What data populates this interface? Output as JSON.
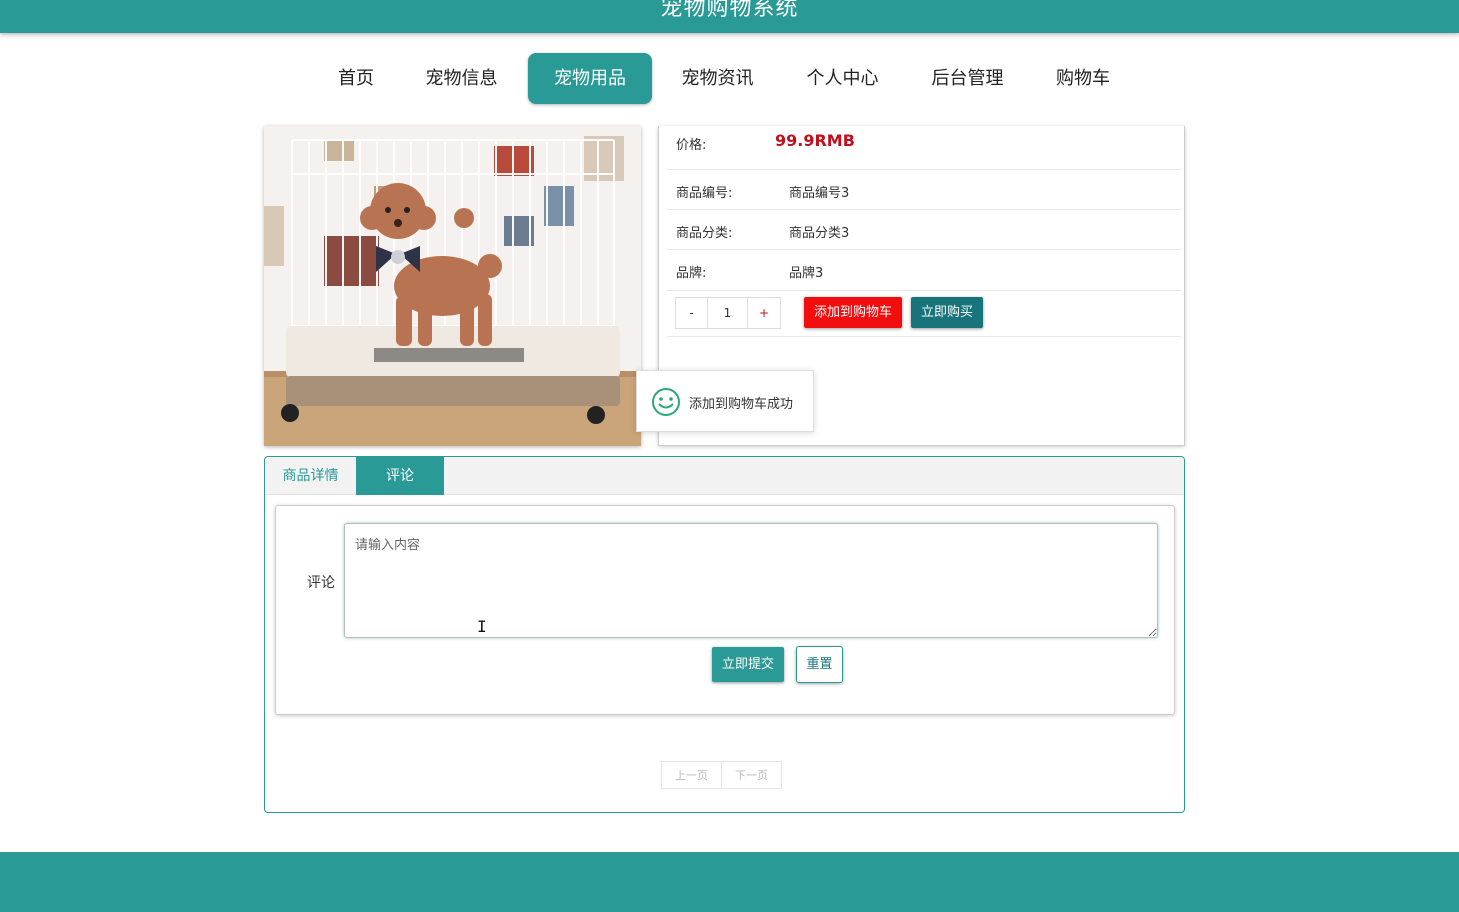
{
  "site": {
    "title": "宠物购物系统"
  },
  "nav": {
    "items": [
      {
        "label": "首页",
        "active": false
      },
      {
        "label": "宠物信息",
        "active": false
      },
      {
        "label": "宠物用品",
        "active": true
      },
      {
        "label": "宠物资讯",
        "active": false
      },
      {
        "label": "个人中心",
        "active": false
      },
      {
        "label": "后台管理",
        "active": false
      },
      {
        "label": "购物车",
        "active": false
      }
    ]
  },
  "product": {
    "image_icon": "dog-in-cage-photo",
    "price": {
      "label": "价格:",
      "value": "99.9RMB"
    },
    "fields": [
      {
        "label": "商品编号:",
        "value": "商品编号3"
      },
      {
        "label": "商品分类:",
        "value": "商品分类3"
      },
      {
        "label": "品牌:",
        "value": "品牌3"
      }
    ],
    "quantity": {
      "minus": "-",
      "value": "1",
      "plus": "+"
    },
    "add_to_cart_label": "添加到购物车",
    "buy_now_label": "立即购买"
  },
  "toast": {
    "icon": "smile-icon",
    "text": "添加到购物车成功"
  },
  "tabs": {
    "items": [
      {
        "label": "商品详情",
        "active": false
      },
      {
        "label": "评论",
        "active": true
      }
    ]
  },
  "comment_form": {
    "label": "评论",
    "placeholder": "请输入内容",
    "submit_label": "立即提交",
    "reset_label": "重置"
  },
  "pager": {
    "prev_label": "上一页",
    "next_label": "下一页"
  },
  "colors": {
    "primary": "#2a9a97",
    "dark_teal": "#18747a",
    "red": "#f20e0e",
    "price_red": "#c0101e"
  }
}
